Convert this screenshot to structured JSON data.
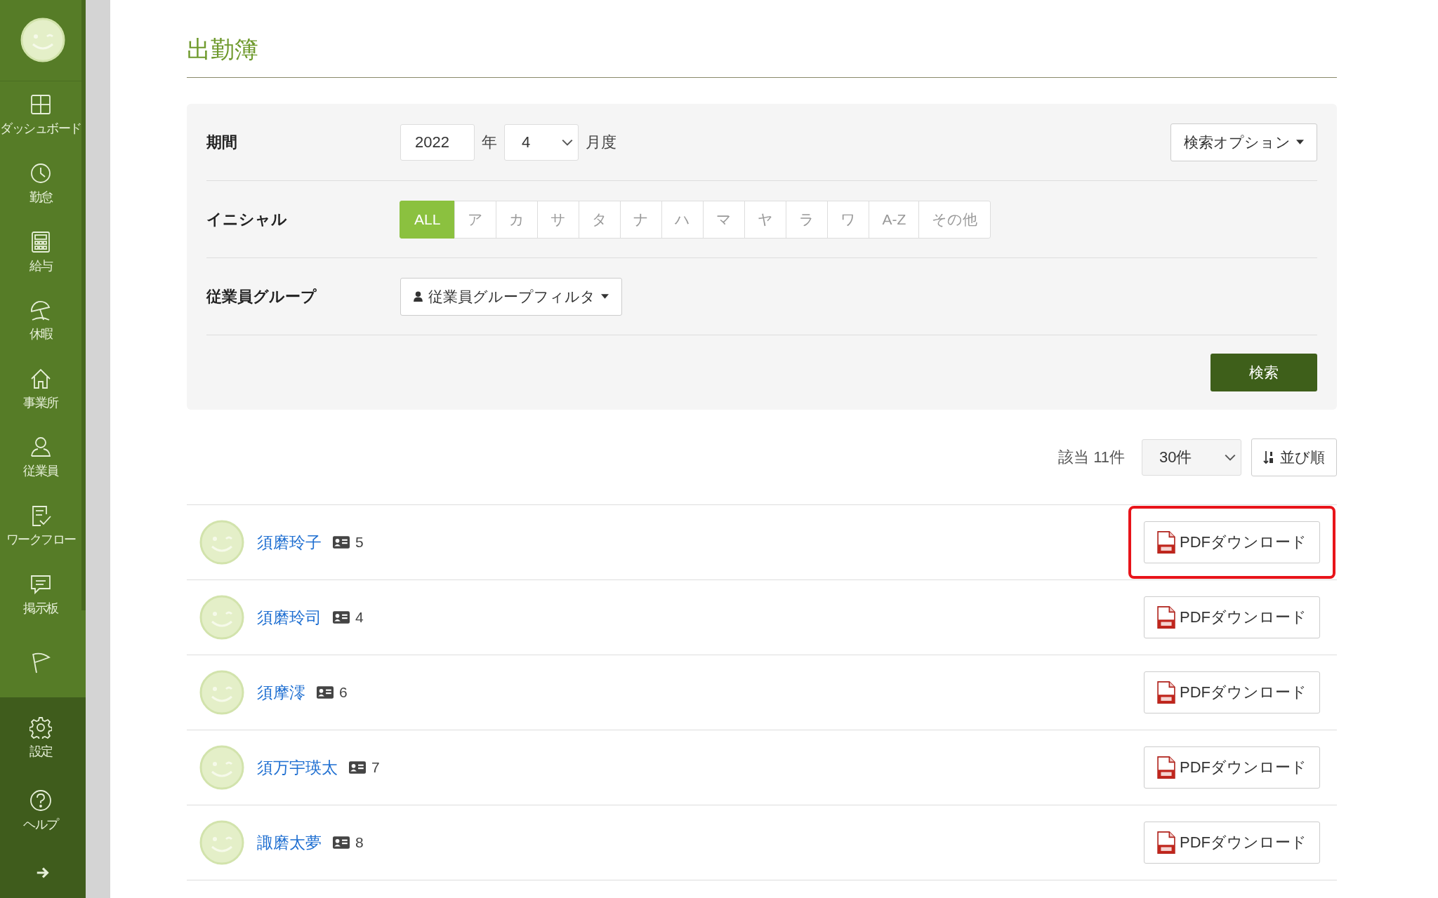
{
  "sidebar": {
    "items": [
      {
        "label": "ダッシュボード"
      },
      {
        "label": "勤怠"
      },
      {
        "label": "給与"
      },
      {
        "label": "休暇"
      },
      {
        "label": "事業所"
      },
      {
        "label": "従業員"
      },
      {
        "label": "ワークフロー"
      },
      {
        "label": "掲示板"
      },
      {
        "kind": "icon_only"
      }
    ],
    "footer_items": [
      {
        "label": "設定"
      },
      {
        "label": "ヘルプ"
      },
      {
        "kind": "icon_only"
      }
    ]
  },
  "title": "出勤簿",
  "filters": {
    "period": {
      "label": "期間",
      "year": "2022",
      "year_unit": "年",
      "month": "4",
      "month_unit": "月度"
    },
    "search_options": "検索オプション",
    "initials": {
      "label": "イニシャル",
      "options": [
        {
          "label": "ALL",
          "selected": true
        },
        {
          "label": "ア",
          "selected": false
        },
        {
          "label": "カ",
          "selected": false
        },
        {
          "label": "サ",
          "selected": false
        },
        {
          "label": "タ",
          "selected": false
        },
        {
          "label": "ナ",
          "selected": false
        },
        {
          "label": "ハ",
          "selected": false
        },
        {
          "label": "マ",
          "selected": false
        },
        {
          "label": "ヤ",
          "selected": false
        },
        {
          "label": "ラ",
          "selected": false
        },
        {
          "label": "ワ",
          "selected": false
        },
        {
          "label": "A-Z",
          "selected": false
        },
        {
          "label": "その他",
          "selected": false
        }
      ]
    },
    "group": {
      "label": "従業員グループ",
      "button": "従業員グループフィルタ"
    },
    "search_button": "検索"
  },
  "results": {
    "count": "該当 11件",
    "per_page": "30件",
    "sort": "並び順"
  },
  "employees": [
    {
      "name": "須磨玲子",
      "number": "5",
      "button": "PDFダウンロード",
      "highlighted": true
    },
    {
      "name": "須磨玲司",
      "number": "4",
      "button": "PDFダウンロード",
      "highlighted": false
    },
    {
      "name": "須摩澪",
      "number": "6",
      "button": "PDFダウンロード",
      "highlighted": false
    },
    {
      "name": "須万宇瑛太",
      "number": "7",
      "button": "PDFダウンロード",
      "highlighted": false
    },
    {
      "name": "諏磨太夢",
      "number": "8",
      "button": "PDFダウンロード",
      "highlighted": false
    }
  ]
}
